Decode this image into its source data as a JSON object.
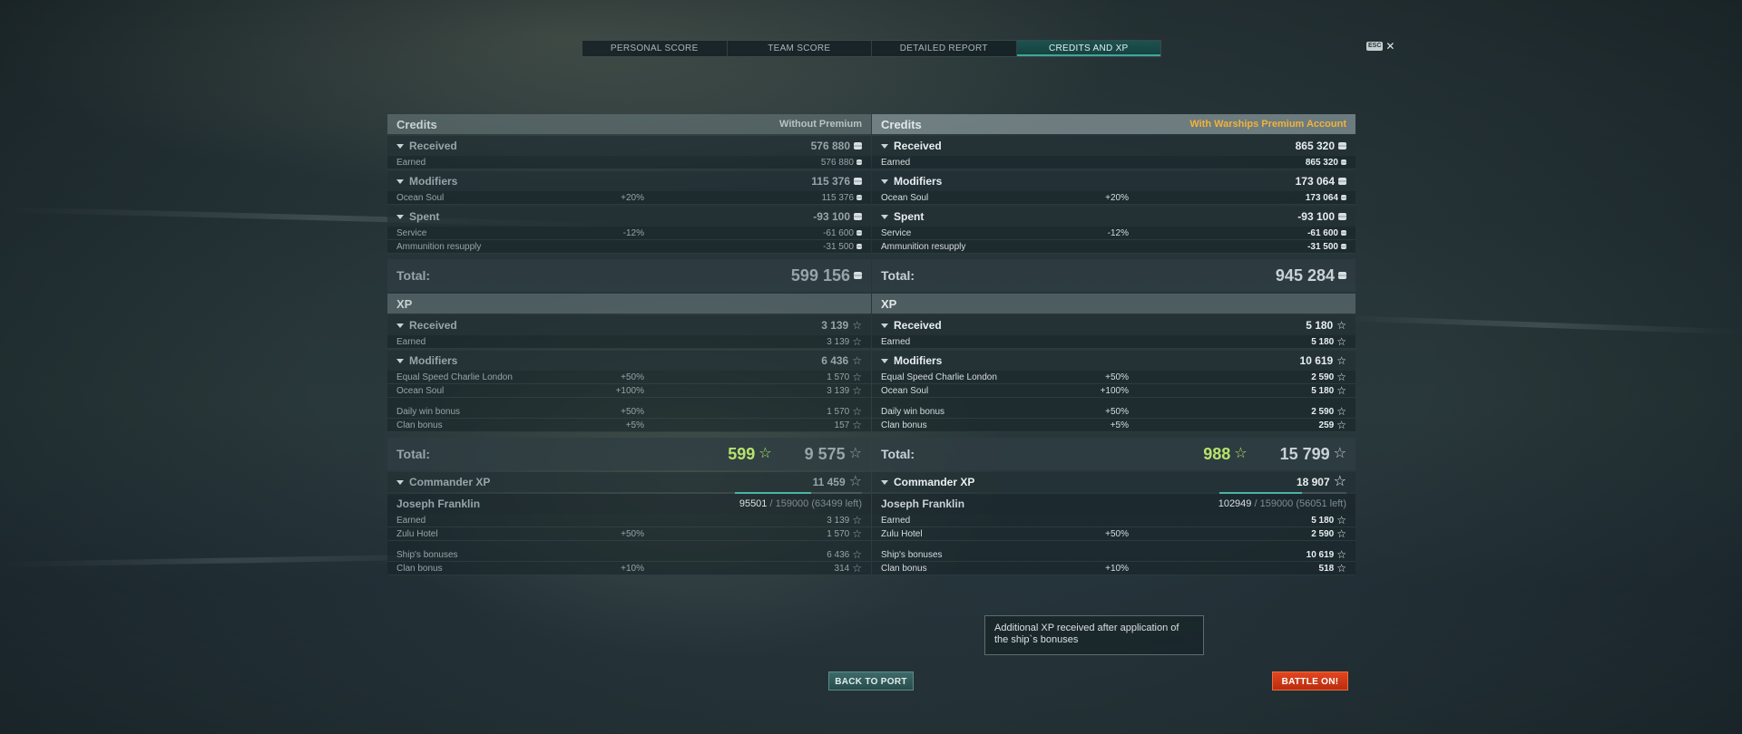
{
  "tabs": [
    "PERSONAL SCORE",
    "TEAM SCORE",
    "DETAILED REPORT",
    "CREDITS AND XP"
  ],
  "active_tab": "CREDITS AND XP",
  "esc_label": "ESC",
  "close_glyph": "✕",
  "left": {
    "credits_title": "Credits",
    "credits_sub": "Without Premium",
    "received": {
      "label": "Received",
      "value": "576 880"
    },
    "earned": {
      "label": "Earned",
      "value": "576 880"
    },
    "modifiers": {
      "label": "Modifiers",
      "value": "115 376"
    },
    "ocean_soul": {
      "label": "Ocean Soul",
      "pct": "+20%",
      "value": "115 376"
    },
    "spent": {
      "label": "Spent",
      "value": "-93 100"
    },
    "service": {
      "label": "Service",
      "pct": "-12%",
      "value": "-61 600"
    },
    "ammo": {
      "label": "Ammunition resupply",
      "value": "-31 500"
    },
    "credits_total": {
      "label": "Total:",
      "value": "599 156"
    },
    "xp_title": "XP",
    "xp_received": {
      "label": "Received",
      "value": "3 139"
    },
    "xp_earned": {
      "label": "Earned",
      "value": "3 139"
    },
    "xp_modifiers": {
      "label": "Modifiers",
      "value": "6 436"
    },
    "charlie": {
      "label": "Equal Speed Charlie London",
      "pct": "+50%",
      "value": "1 570"
    },
    "xp_ocean": {
      "label": "Ocean Soul",
      "pct": "+100%",
      "value": "3 139"
    },
    "daily": {
      "label": "Daily win bonus",
      "pct": "+50%",
      "value": "1 570"
    },
    "clan": {
      "label": "Clan bonus",
      "pct": "+5%",
      "value": "157"
    },
    "xp_total": {
      "label": "Total:",
      "bonus": "599",
      "value": "9 575"
    },
    "cmd": {
      "label": "Commander XP",
      "value": "11 459"
    },
    "cmd_name": "Joseph Franklin",
    "cmd_cur": "95501",
    "cmd_rest": " / 159000 (63499 left)",
    "cmd_progress": 0.6,
    "cmd_earned": {
      "label": "Earned",
      "value": "3 139"
    },
    "zulu": {
      "label": "Zulu Hotel",
      "pct": "+50%",
      "value": "1 570"
    },
    "ship_bonus": {
      "label": "Ship's bonuses",
      "value": "6 436"
    },
    "cmd_clan": {
      "label": "Clan bonus",
      "pct": "+10%",
      "value": "314"
    }
  },
  "right": {
    "credits_title": "Credits",
    "credits_sub": "With Warships Premium Account",
    "received": {
      "label": "Received",
      "value": "865 320"
    },
    "earned": {
      "label": "Earned",
      "value": "865 320"
    },
    "modifiers": {
      "label": "Modifiers",
      "value": "173 064"
    },
    "ocean_soul": {
      "label": "Ocean Soul",
      "pct": "+20%",
      "value": "173 064"
    },
    "spent": {
      "label": "Spent",
      "value": "-93 100"
    },
    "service": {
      "label": "Service",
      "pct": "-12%",
      "value": "-61 600"
    },
    "ammo": {
      "label": "Ammunition resupply",
      "value": "-31 500"
    },
    "credits_total": {
      "label": "Total:",
      "value": "945 284"
    },
    "xp_title": "XP",
    "xp_received": {
      "label": "Received",
      "value": "5 180"
    },
    "xp_earned": {
      "label": "Earned",
      "value": "5 180"
    },
    "xp_modifiers": {
      "label": "Modifiers",
      "value": "10 619"
    },
    "charlie": {
      "label": "Equal Speed Charlie London",
      "pct": "+50%",
      "value": "2 590"
    },
    "xp_ocean": {
      "label": "Ocean Soul",
      "pct": "+100%",
      "value": "5 180"
    },
    "daily": {
      "label": "Daily win bonus",
      "pct": "+50%",
      "value": "2 590"
    },
    "clan": {
      "label": "Clan bonus",
      "pct": "+5%",
      "value": "259"
    },
    "xp_total": {
      "label": "Total:",
      "bonus": "988",
      "value": "15 799"
    },
    "cmd": {
      "label": "Commander XP",
      "value": "18 907"
    },
    "cmd_name": "Joseph Franklin",
    "cmd_cur": "102949",
    "cmd_rest": " / 159000 (56051 left)",
    "cmd_progress": 0.65,
    "cmd_earned": {
      "label": "Earned",
      "value": "5 180"
    },
    "zulu": {
      "label": "Zulu Hotel",
      "pct": "+50%",
      "value": "2 590"
    },
    "ship_bonus": {
      "label": "Ship's bonuses",
      "value": "10 619"
    },
    "cmd_clan": {
      "label": "Clan bonus",
      "pct": "+10%",
      "value": "518"
    }
  },
  "tooltip": "Additional XP received after application of the ship`s bonuses",
  "buttons": {
    "back": "BACK TO PORT",
    "battle": "BATTLE ON!"
  },
  "icons": {
    "credits": "credits-icon",
    "xp": "xp-star-icon"
  },
  "colors": {
    "premium": "#f2b23c",
    "bonus_xp": "#b7e36c",
    "battle_btn": "#d23a16",
    "active_tab": "#1d5250"
  }
}
